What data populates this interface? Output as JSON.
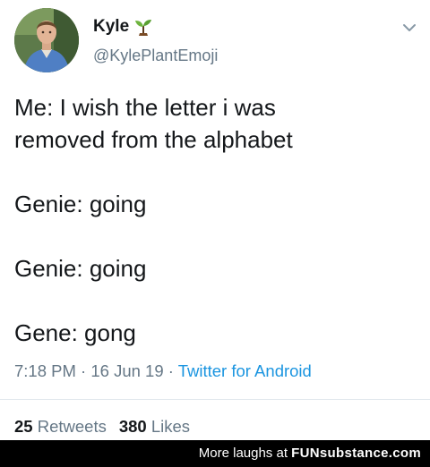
{
  "author": {
    "name": "Kyle",
    "name_emoji": "sprout-icon",
    "handle": "@KylePlantEmoji"
  },
  "tweet": {
    "line1": "Me: I wish the letter i was",
    "line2": "removed from the alphabet",
    "line3": "Genie: going",
    "line4": "Genie: going",
    "line5": "Gene: gong"
  },
  "meta": {
    "time": "7:18 PM",
    "sep1": " · ",
    "date": "16 Jun 19",
    "sep2": " · ",
    "source": "Twitter for Android"
  },
  "stats": {
    "retweets_count": "25",
    "retweets_label": "Retweets",
    "likes_count": "380",
    "likes_label": "Likes"
  },
  "footer": {
    "prefix": "More laughs at ",
    "brand": "FUNsubstance.com"
  },
  "colors": {
    "text": "#14171a",
    "muted": "#657786",
    "link": "#1b95e0",
    "footer_bg": "#000000"
  }
}
